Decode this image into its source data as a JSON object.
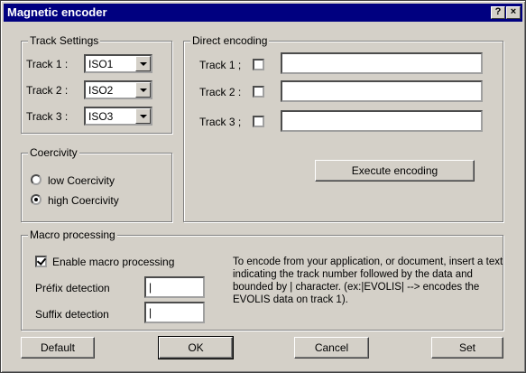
{
  "window": {
    "title": "Magnetic encoder",
    "help_label": "?",
    "close_label": "×"
  },
  "track_settings": {
    "legend": "Track Settings",
    "tracks": [
      {
        "label": "Track 1 :",
        "value": "ISO1"
      },
      {
        "label": "Track 2 :",
        "value": "ISO2"
      },
      {
        "label": "Track 3 :",
        "value": "ISO3"
      }
    ]
  },
  "coercivity": {
    "legend": "Coercivity",
    "options": [
      {
        "label": "low Coercivity",
        "selected": false
      },
      {
        "label": "high Coercivity",
        "selected": true
      }
    ]
  },
  "direct_encoding": {
    "legend": "Direct encoding",
    "tracks": [
      {
        "label": "Track 1 ;",
        "checked": false,
        "value": ""
      },
      {
        "label": "Track 2 :",
        "checked": false,
        "value": ""
      },
      {
        "label": "Track 3 ;",
        "checked": false,
        "value": ""
      }
    ],
    "execute_label": "Execute encoding"
  },
  "macro": {
    "legend": "Macro processing",
    "enable_label": "Enable macro processing",
    "enable_checked": true,
    "prefix_label": "Préfix detection",
    "prefix_value": "|",
    "suffix_label": "Suffix detection",
    "suffix_value": "|",
    "note": "To encode from your application, or document, insert a text indicating the track number followed by the data and bounded by | character. (ex:|EVOLIS| --> encodes the EVOLIS data on track 1)."
  },
  "buttons": {
    "default": "Default",
    "ok": "OK",
    "cancel": "Cancel",
    "set": "Set"
  }
}
